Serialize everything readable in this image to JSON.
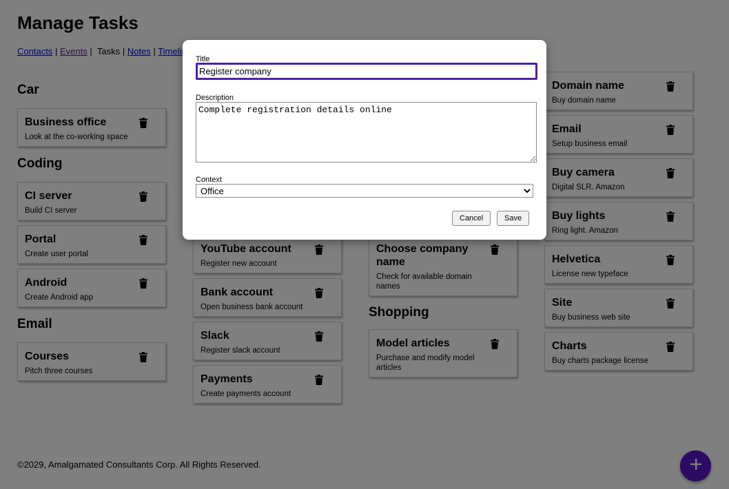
{
  "page": {
    "title": "Manage Tasks"
  },
  "nav": {
    "contacts": "Contacts",
    "events": "Events",
    "tasks": "Tasks",
    "notes": "Notes",
    "timeline": "Timeline",
    "sep": "|"
  },
  "columns": [
    {
      "groups": [
        {
          "context": "Car",
          "tasks": [
            {
              "title": "Business office",
              "description": "Look at the co-working space"
            }
          ]
        },
        {
          "context": "Coding",
          "tasks": [
            {
              "title": "CI server",
              "description": "Build CI server"
            },
            {
              "title": "Portal",
              "description": "Create user portal"
            },
            {
              "title": "Android",
              "description": "Create Android app"
            }
          ]
        },
        {
          "context": "Email",
          "tasks": [
            {
              "title": "Courses",
              "description": "Pitch three courses"
            }
          ]
        }
      ]
    },
    {
      "groups": [
        {
          "context": "",
          "tasks": [
            {
              "title": "YouTube account",
              "description": "Register new account"
            },
            {
              "title": "Bank account",
              "description": "Open business bank account"
            },
            {
              "title": "Slack",
              "description": "Register slack account"
            },
            {
              "title": "Payments",
              "description": "Create payments account"
            }
          ]
        }
      ]
    },
    {
      "groups": [
        {
          "context": "",
          "tasks": [
            {
              "title": "Choose company name",
              "description": "Check for available domain names"
            }
          ]
        },
        {
          "context": "Shopping",
          "tasks": [
            {
              "title": "Model articles",
              "description": "Purchase and modify model articles"
            }
          ]
        }
      ]
    },
    {
      "groups": [
        {
          "context": "",
          "tasks": [
            {
              "title": "Domain name",
              "description": "Buy domain name"
            },
            {
              "title": "Email",
              "description": "Setup business email"
            },
            {
              "title": "Buy camera",
              "description": "Digital SLR. Amazon"
            },
            {
              "title": "Buy lights",
              "description": "Ring light. Amazon"
            },
            {
              "title": "Helvetica",
              "description": "License new typeface"
            },
            {
              "title": "Site",
              "description": "Buy business web site"
            },
            {
              "title": "Charts",
              "description": "Buy charts package license"
            }
          ]
        }
      ]
    }
  ],
  "footer": {
    "text": "©2029, Amalgamated Consultants Corp. All Rights Reserved."
  },
  "fab": {
    "icon": "plus-icon",
    "label": "+"
  },
  "modal": {
    "title_label": "Title",
    "title_value": "Register company",
    "description_label": "Description",
    "description_value": "Complete registration details online",
    "context_label": "Context",
    "context_value": "Office",
    "cancel_label": "Cancel",
    "save_label": "Save"
  },
  "colors": {
    "accent": "#5b17c8",
    "focus": "#4b1fb5",
    "overlay": "rgba(0,0,0,0.5)"
  },
  "icons": {
    "delete": "trash-icon"
  }
}
